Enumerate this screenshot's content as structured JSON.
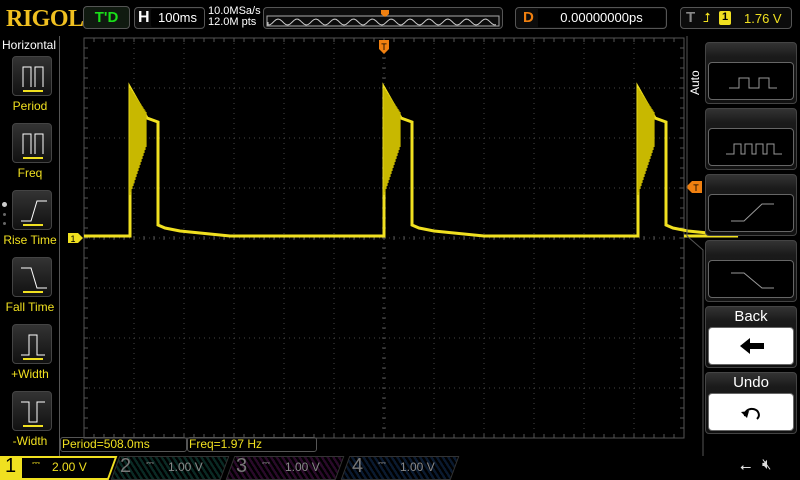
{
  "header": {
    "logo": "RIGOL",
    "run_status": "T'D",
    "horizontal_label": "H",
    "timebase": "100ms",
    "sample_rate": "10.0MSa/s",
    "memory_depth": "12.0M pts",
    "delay_label": "D",
    "delay": "0.00000000ps",
    "trigger_label": "T",
    "trigger_source": "1",
    "trigger_level": "1.76 V"
  },
  "left_menu": {
    "title": "Horizontal",
    "items": [
      {
        "label": "Period"
      },
      {
        "label": "Freq"
      },
      {
        "label": "Rise Time"
      },
      {
        "label": "Fall Time"
      },
      {
        "label": "+Width"
      },
      {
        "label": "-Width"
      }
    ]
  },
  "right_menu": {
    "mode": "Auto",
    "back": "Back",
    "undo": "Undo"
  },
  "measurements": {
    "period": "Period=508.0ms",
    "freq": "Freq=1.97 Hz"
  },
  "channels": [
    {
      "num": "1",
      "scale": "2.00 V",
      "color": "#f0e020",
      "active": true
    },
    {
      "num": "2",
      "scale": "1.00 V",
      "color": "#1a6a5a"
    },
    {
      "num": "3",
      "scale": "1.00 V",
      "color": "#7a1a7a"
    },
    {
      "num": "4",
      "scale": "1.00 V",
      "color": "#1a4a7a"
    }
  ],
  "markers": {
    "ch1": "1",
    "trigger": "T"
  },
  "colors": {
    "ch1": "#f0e020",
    "trigger": "#f08010"
  }
}
